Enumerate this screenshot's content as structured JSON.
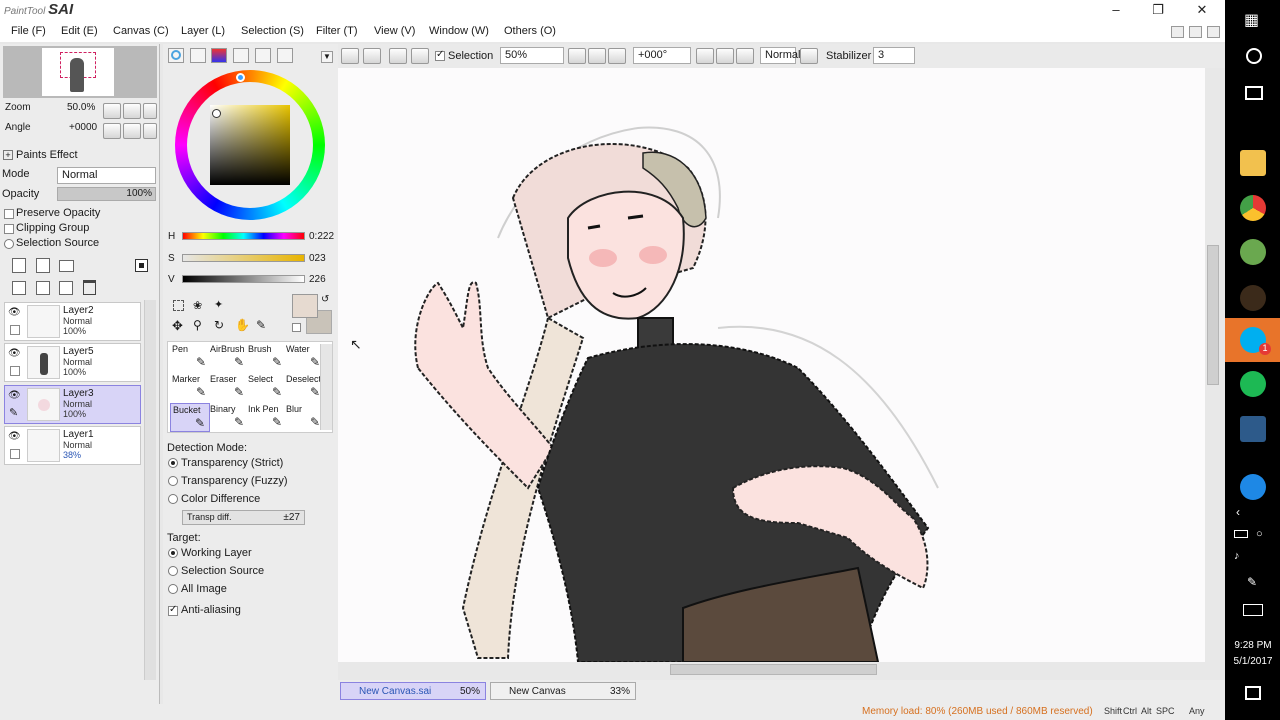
{
  "app": {
    "logo_small": "PaintTool",
    "logo_big": "SAI"
  },
  "menu": [
    "File (F)",
    "Edit (E)",
    "Canvas (C)",
    "Layer (L)",
    "Selection (S)",
    "Filter (T)",
    "View (V)",
    "Window (W)",
    "Others (O)"
  ],
  "toolbar": {
    "selection_label": "Selection",
    "zoom_value": "50%",
    "angle_value": "+000°",
    "blend_mode": "Normal",
    "stabilizer_label": "Stabilizer",
    "stabilizer_value": "3"
  },
  "navigator": {
    "zoom_label": "Zoom",
    "zoom_value": "50.0%",
    "angle_label": "Angle",
    "angle_value": "+0000"
  },
  "paints": {
    "header": "Paints Effect",
    "mode_label": "Mode",
    "mode_value": "Normal",
    "opacity_label": "Opacity",
    "opacity_value": "100%",
    "preserve": "Preserve Opacity",
    "clipping": "Clipping Group",
    "selection_source": "Selection Source"
  },
  "layers": [
    {
      "name": "Layer2",
      "mode": "Normal",
      "opacity": "100%",
      "selected": false
    },
    {
      "name": "Layer5",
      "mode": "Normal",
      "opacity": "100%",
      "selected": false
    },
    {
      "name": "Layer3",
      "mode": "Normal",
      "opacity": "100%",
      "selected": true
    },
    {
      "name": "Layer1",
      "mode": "Normal",
      "opacity": "38%",
      "selected": false
    }
  ],
  "color": {
    "h_label": "H",
    "h_value": "0:222",
    "s_label": "S",
    "s_value": "023",
    "v_label": "V",
    "v_value": "226",
    "primary": "#e6dad0"
  },
  "tools": [
    {
      "name": "Pen",
      "selected": false
    },
    {
      "name": "AirBrush",
      "selected": false
    },
    {
      "name": "Brush",
      "selected": false
    },
    {
      "name": "Water",
      "selected": false
    },
    {
      "name": "Marker",
      "selected": false
    },
    {
      "name": "Eraser",
      "selected": false
    },
    {
      "name": "Select",
      "selected": false
    },
    {
      "name": "Deselect",
      "selected": false
    },
    {
      "name": "Bucket",
      "selected": true
    },
    {
      "name": "Binary",
      "selected": false
    },
    {
      "name": "Ink Pen",
      "selected": false
    },
    {
      "name": "Blur",
      "selected": false
    }
  ],
  "bucket": {
    "detection_label": "Detection Mode:",
    "detection_options": [
      "Transparency (Strict)",
      "Transparency (Fuzzy)",
      "Color Difference"
    ],
    "detection_selected": 0,
    "transp_label": "Transp diff.",
    "transp_value": "±27",
    "target_label": "Target:",
    "target_options": [
      "Working Layer",
      "Selection Source",
      "All Image"
    ],
    "target_selected": 0,
    "antialias_label": "Anti-aliasing"
  },
  "documents": [
    {
      "name": "New Canvas.sai",
      "zoom": "50%",
      "active": true
    },
    {
      "name": "New Canvas",
      "zoom": "33%",
      "active": false
    }
  ],
  "status": {
    "memory": "Memory load: 80% (260MB used / 860MB reserved)",
    "keys": [
      "Shift",
      "Ctrl",
      "Alt",
      "SPC",
      "Any"
    ]
  },
  "taskbar": {
    "time": "9:28 PM",
    "date": "5/1/2017",
    "skype_badge": "1"
  },
  "colors": {
    "accent": "#8b83e0",
    "selected_bg": "#d8d4f7",
    "memory_text": "#d6701f"
  }
}
